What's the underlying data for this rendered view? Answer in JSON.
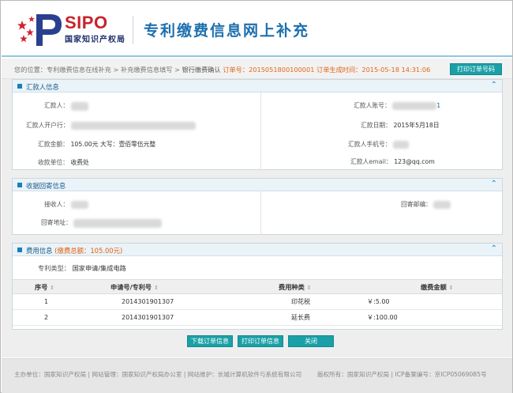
{
  "header": {
    "logo_en": "SIPO",
    "logo_cn": "国家知识产权局",
    "title": "专利缴费信息网上补充"
  },
  "breadcrumb": {
    "prefix": "您的位置：",
    "step1": "专利缴费信息在线补充",
    "step2": "补充缴费信息填写",
    "step3": "银行缴费确认",
    "order_no_label": "订单号：",
    "order_no": "2015051800100001",
    "order_time_label": "订单生成时间：",
    "order_time": "2015-05-18 14:31:06",
    "sep": ">",
    "print_order_no_button": "打印订单号码"
  },
  "payer": {
    "title": "汇款人信息",
    "payer_label": "汇款人：",
    "bank_label": "汇款人开户行：",
    "amount_label": "汇款金额：",
    "amount_value": "105.00元",
    "amount_upper_label": "大写：",
    "amount_upper": "壹佰零伍元整",
    "receiver_unit_label": "收款单位：",
    "receiver_unit": "收费处",
    "account_label": "汇款人账号：",
    "date_label": "汇款日期：",
    "date_value": "2015年5月18日",
    "mobile_label": "汇款人手机号：",
    "email_label": "汇款人email：",
    "email_value": "123@qq.com",
    "account_tail": "1"
  },
  "receipt": {
    "title": "收据回寄信息",
    "receiver_label": "接收人：",
    "address_label": "回寄地址：",
    "postcode_label": "回寄邮编："
  },
  "fee": {
    "title": "费用信息",
    "total_label": "(缴费总额：",
    "total_value": "105.00元",
    "total_close": ")",
    "patent_type_label": "专利类型：",
    "patent_type": "国家申请/集成电路",
    "columns": [
      "序号",
      "申请号/专利号",
      "费用种类",
      "缴费金额"
    ],
    "rows": [
      {
        "no": "1",
        "app_no": "2014301901307",
        "kind": "印花税",
        "amount": "￥:5.00"
      },
      {
        "no": "2",
        "app_no": "2014301901307",
        "kind": "延长费",
        "amount": "￥:100.00"
      }
    ]
  },
  "actions": {
    "download": "下载订单信息",
    "print": "打印订单信息",
    "close": "关闭"
  },
  "footer": {
    "left": "主办单位：国家知识产权局 | 网站管理：国家知识产权局办公室 | 网站维护：长城计算机软件与系统有限公司",
    "right": "版权所有：国家知识产权局 | ICP备案编号：京ICP05069085号"
  },
  "colors": {
    "accent": "#1aa0a6",
    "title_blue": "#1d70ae",
    "orange": "#e0691a",
    "brand_red": "#c8232c"
  }
}
